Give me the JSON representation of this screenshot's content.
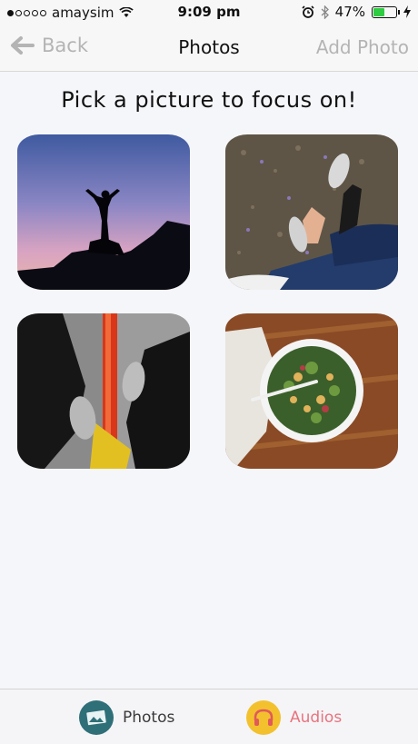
{
  "status": {
    "carrier": "amaysim",
    "time": "9:09 pm",
    "battery": "47%",
    "battery_level": 0.47
  },
  "nav": {
    "back_label": "Back",
    "title": "Photos",
    "add_label": "Add Photo"
  },
  "prompt": "Pick a picture to focus on!",
  "tabs": [
    {
      "label": "Photos",
      "color": "#3a3a3a",
      "icon_bg": "#2f6f78"
    },
    {
      "label": "Audios",
      "color": "#e8737f",
      "icon_bg": "#f3c12e"
    }
  ]
}
